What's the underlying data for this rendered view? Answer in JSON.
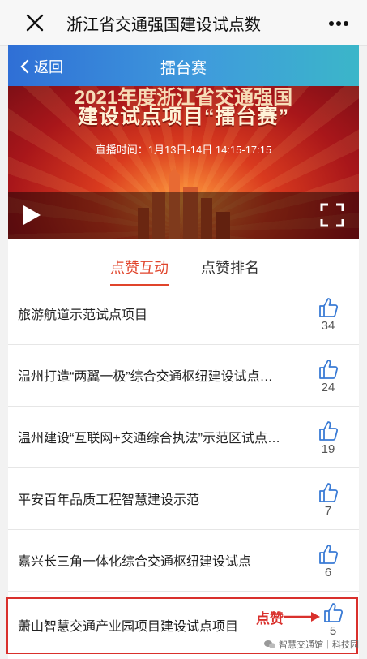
{
  "topbar": {
    "title": "浙江省交通强国建设试点数"
  },
  "navbar": {
    "back_label": "返回",
    "page_title": "擂台赛"
  },
  "banner": {
    "line1": "2021年度浙江省交通强国",
    "line2": "建设试点项目“擂台赛”",
    "time": "直播时间：1月13日-14日 14:15-17:15"
  },
  "tabs": [
    {
      "label": "点赞互动",
      "active": true
    },
    {
      "label": "点赞排名",
      "active": false
    }
  ],
  "items": [
    {
      "name": "旅游航道示范试点项目",
      "likes": "34"
    },
    {
      "name": "温州打造“两翼一极”综合交通枢纽建设试点…",
      "likes": "24"
    },
    {
      "name": "温州建设“互联网+交通综合执法”示范区试点…",
      "likes": "19"
    },
    {
      "name": "平安百年品质工程智慧建设示范",
      "likes": "7"
    },
    {
      "name": "嘉兴长三角一体化综合交通枢纽建设试点",
      "likes": "6"
    },
    {
      "name": "萧山智慧交通产业园项目建设试点项目",
      "likes": "5"
    }
  ],
  "annotation": {
    "text": "点赞",
    "color": "#d9302c"
  },
  "watermark": {
    "text": "智慧交通馆｜科技园"
  },
  "colors": {
    "accent": "#e0442b",
    "like_icon": "#3a7bd5",
    "nav_start": "#2f6fd6",
    "nav_end": "#3bb6c9"
  }
}
